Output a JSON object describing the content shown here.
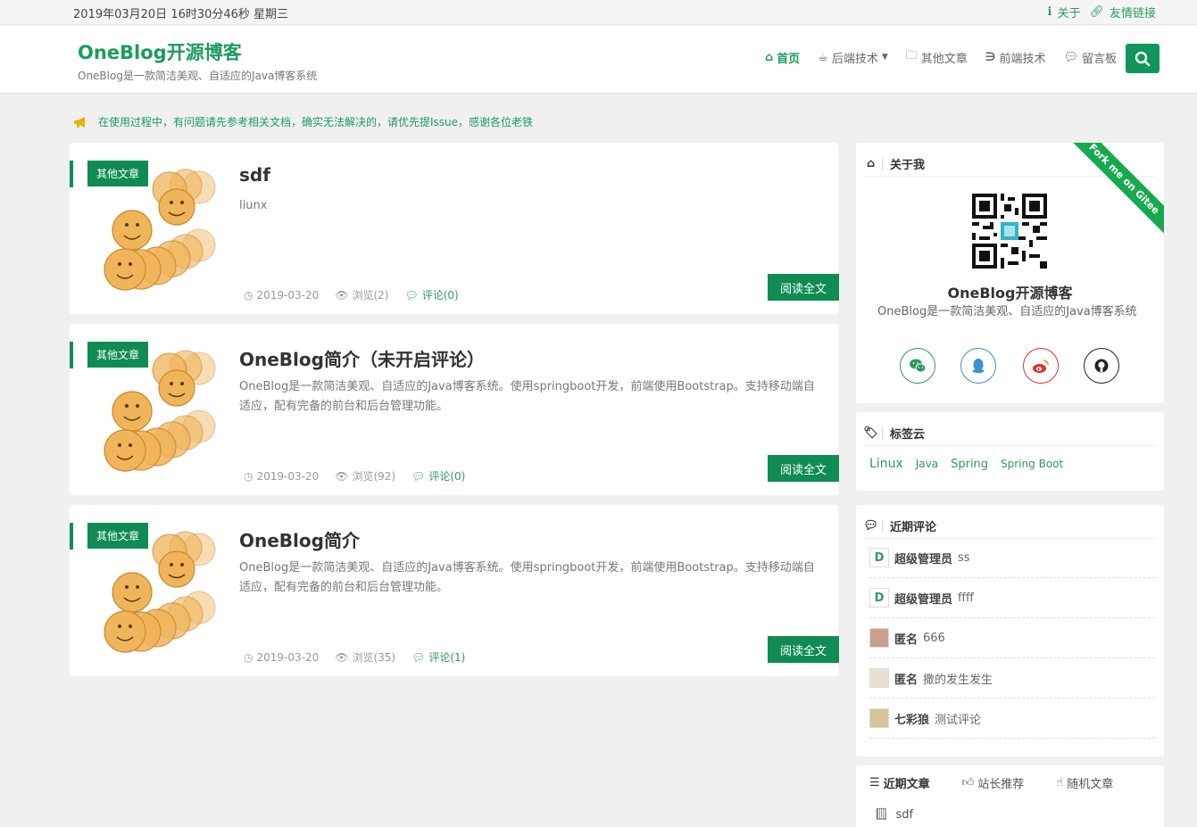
{
  "topbar": {
    "datetime": "2019年03月20日 16时30分46秒 星期三",
    "links": [
      "关于",
      "友情链接"
    ]
  },
  "header": {
    "brand": "OneBlog开源博客",
    "subtitle": "OneBlog是一款简洁美观、自适应的Java博客系统",
    "nav": [
      "首页",
      "后端技术",
      "其他文章",
      "前端技术",
      "留言板"
    ]
  },
  "notice": "在使用过程中，有问题请先参考相关文档，确实无法解决的，请优先提Issue，感谢各位老铁",
  "articles": [
    {
      "badge": "其他文章",
      "title": "sdf",
      "summary": "liunx",
      "date": "2019-03-20",
      "views": "浏览(2)",
      "comments": "评论(0)",
      "read": "阅读全文"
    },
    {
      "badge": "其他文章",
      "title": "OneBlog简介（未开启评论）",
      "summary": "OneBlog是一款简洁美观、自适应的Java博客系统。使用springboot开发，前端使用Bootstrap。支持移动端自适应，配有完备的前台和后台管理功能。",
      "date": "2019-03-20",
      "views": "浏览(92)",
      "comments": "评论(0)",
      "read": "阅读全文"
    },
    {
      "badge": "其他文章",
      "title": "OneBlog简介",
      "summary": "OneBlog是一款简洁美观、自适应的Java博客系统。使用springboot开发，前端使用Bootstrap。支持移动端自适应，配有完备的前台和后台管理功能。",
      "date": "2019-03-20",
      "views": "浏览(35)",
      "comments": "评论(1)",
      "read": "阅读全文"
    }
  ],
  "about": {
    "heading": "关于我",
    "ribbon": "Fork me on Gitee",
    "name": "OneBlog开源博客",
    "desc": "OneBlog是一款简洁美观、自适应的Java博客系统",
    "social": [
      {
        "icon": "wechat-icon",
        "color": "#2e9a5c"
      },
      {
        "icon": "qq-icon",
        "color": "#3d8fd1"
      },
      {
        "icon": "weibo-icon",
        "color": "#d33"
      },
      {
        "icon": "github-icon",
        "color": "#222"
      }
    ]
  },
  "tagcloud": {
    "heading": "标签云",
    "tags": [
      "Linux",
      "Java",
      "Spring",
      "Spring Boot"
    ]
  },
  "recent_comments": {
    "heading": "近期评论",
    "items": [
      {
        "user": "超级管理员",
        "text": "ss",
        "avatar": "D"
      },
      {
        "user": "超级管理员",
        "text": "ffff",
        "avatar": "D"
      },
      {
        "user": "匿名",
        "text": "666",
        "avatar": ""
      },
      {
        "user": "匿名",
        "text": "撒的发生发生",
        "avatar": ""
      },
      {
        "user": "七彩狼",
        "text": "测试评论",
        "avatar": ""
      }
    ]
  },
  "article_tabs": {
    "tabs": [
      "近期文章",
      "站长推荐",
      "随机文章"
    ],
    "first_item": "sdf"
  },
  "colors": {
    "primary": "#0f8c54",
    "accent": "#1a9c5e"
  }
}
